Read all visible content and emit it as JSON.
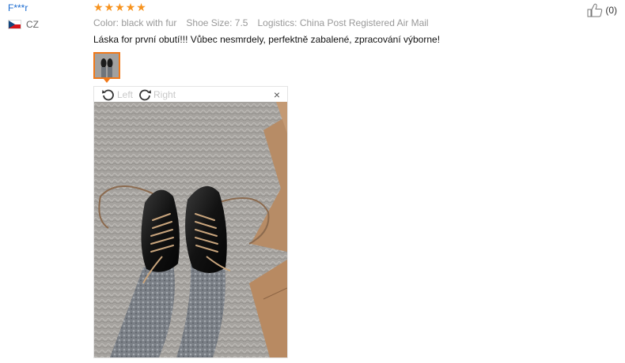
{
  "reviewer": {
    "name": "F***r",
    "country": "CZ"
  },
  "review": {
    "rating": 5,
    "meta": {
      "color_label": "Color:",
      "color_value": "black with fur",
      "size_label": "Shoe Size:",
      "size_value": "7.5",
      "logistics_label": "Logistics:",
      "logistics_value": "China Post Registered Air Mail"
    },
    "text": "Láska for první obutí!!! Vůbec nesmrdely, perfektně zabalené, zpracování výborne!"
  },
  "helpful": {
    "count": "(0)"
  },
  "viewer": {
    "rotate_left": "Left",
    "rotate_right": "Right",
    "close": "×"
  },
  "colors": {
    "accent": "#f07818",
    "star": "#f7931e",
    "link": "#1a6bd0"
  }
}
